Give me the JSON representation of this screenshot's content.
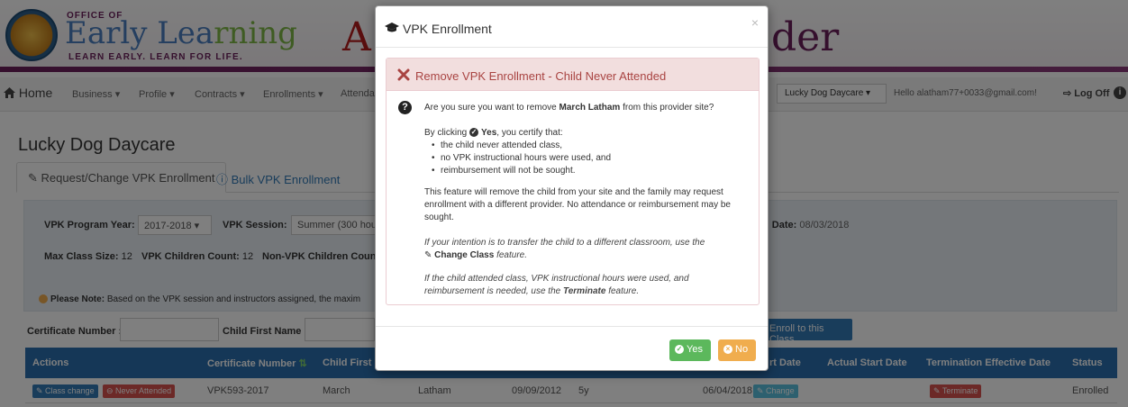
{
  "banner": {
    "office_of": "OFFICE OF",
    "title_part1": "Early Lea",
    "title_part2": "rning",
    "tagline": "LEARN EARLY. LEARN FOR LIFE.",
    "big_left": "A",
    "big_right": "der"
  },
  "nav": {
    "home": "Home",
    "items": [
      "Business ▾",
      "Profile ▾",
      "Contracts ▾",
      "Enrollments ▾",
      "Attenda"
    ],
    "provider": "Lucky Dog Daycare",
    "hello": "Hello alatham77+0033@gmail.com!",
    "logoff": "Log Off"
  },
  "page": {
    "title": "Lucky Dog Daycare",
    "tab_active": "Request/Change VPK Enrollment",
    "tab_other": "Bulk VPK Enrollment"
  },
  "panel": {
    "program_year_label": "VPK Program Year:",
    "program_year_value": "2017-2018",
    "session_label": "VPK Session:",
    "session_value": "Summer (300 hou",
    "end_date_label": "d Date:",
    "end_date_value": "08/03/2018",
    "max_class_label": "Max Class Size:",
    "max_class_value": "12",
    "vpk_count_label": "VPK Children Count:",
    "vpk_count_value": "12",
    "nonvpk_label": "Non-VPK Children Count:",
    "note_label": "Please Note:",
    "note_text": "Based on the VPK session and instructors assigned, the maxim"
  },
  "filters": {
    "cert_label": "Certificate Number :",
    "first_label": "Child First Name :",
    "enroll_button": "Enroll to this Class"
  },
  "table": {
    "headers": [
      "Actions",
      "Certificate Number",
      "Child First N",
      "rt Date",
      "Actual Start Date",
      "Termination Effective Date",
      "Status"
    ],
    "row": {
      "class_change": "Class change",
      "never_attended": "Never Attended",
      "certificate": "VPK593-2017",
      "first": "March",
      "last": "Latham",
      "dob": "09/09/2012",
      "age": "5y",
      "start": "06/04/2018",
      "change": "Change",
      "terminate": "Terminate",
      "status": "Enrolled"
    }
  },
  "modal": {
    "title": "VPK Enrollment",
    "close": "×",
    "panel_heading": "Remove VPK Enrollment - Child Never Attended",
    "question_prefix": "Are you sure you want to remove ",
    "child_name": "March Latham",
    "question_suffix": " from this provider site?",
    "certify_prefix": "By clicking ",
    "certify_yes": "Yes",
    "certify_suffix": ", you certify that:",
    "bullets": [
      "the child never attended class,",
      "no VPK instructional hours were used, and",
      "reimbursement will not be sought."
    ],
    "feature_text": "This feature will remove the child from your site and the family may request enrollment with a different provider. No attendance or reimbursement may be sought.",
    "transfer_text": "If your intention is to transfer the child to a different classroom, use the",
    "change_class": "Change Class",
    "feature_word": "feature.",
    "attended_text": "If the child attended class, VPK instructional hours were used, and reimbursement is needed, use the",
    "terminate_word": "Terminate",
    "feature_word2": "feature.",
    "yes_button": "Yes",
    "no_button": "No"
  }
}
